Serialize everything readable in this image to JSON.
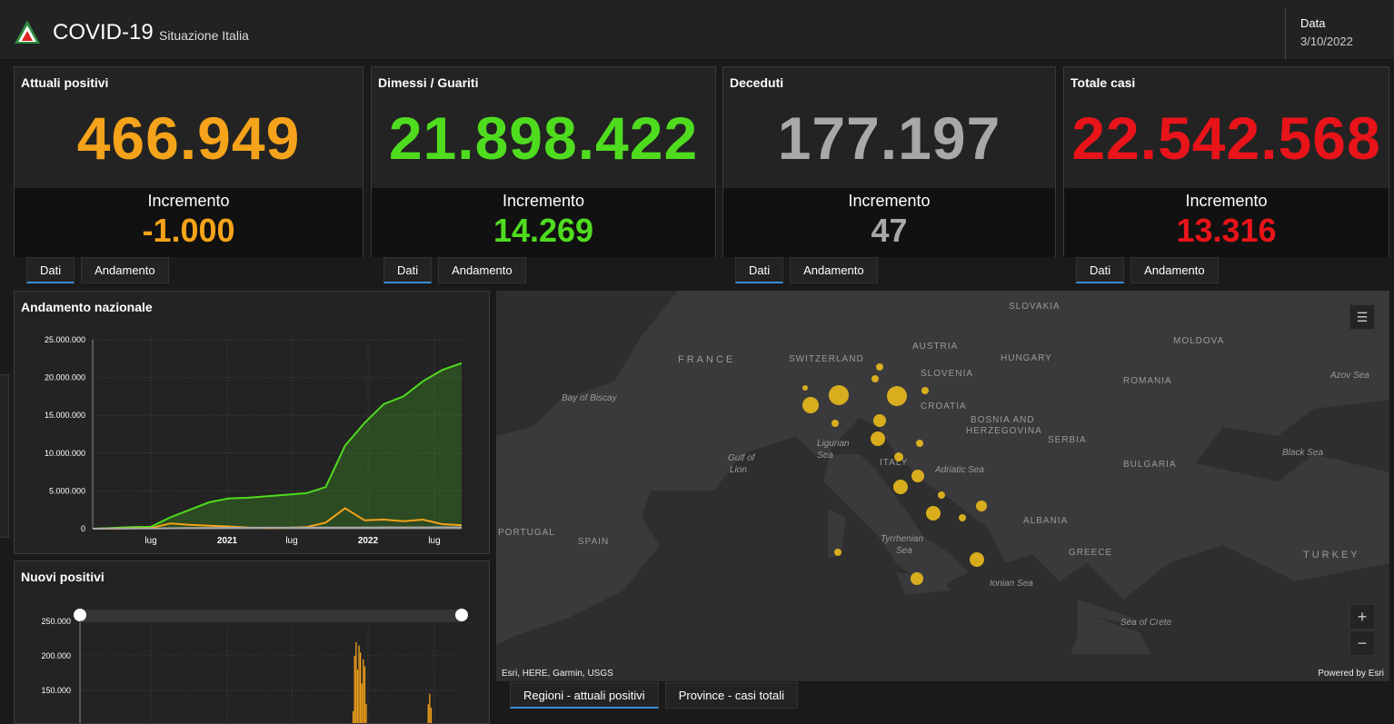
{
  "header": {
    "title": "COVID-19",
    "subtitle": "Situazione Italia",
    "date_label": "Data",
    "date_value": "3/10/2022",
    "logo_icon": "italy-civil-protection-logo"
  },
  "cards": [
    {
      "title": "Attuali positivi",
      "value": "466.949",
      "increment_label": "Incremento",
      "increment": "-1.000",
      "color": "#f5a31a"
    },
    {
      "title": "Dimessi / Guariti",
      "value": "21.898.422",
      "increment_label": "Incremento",
      "increment": "14.269",
      "color": "#4fdc1f"
    },
    {
      "title": "Deceduti",
      "value": "177.197",
      "increment_label": "Incremento",
      "increment": "47",
      "color": "#a8a8a8"
    },
    {
      "title": "Totale casi",
      "value": "22.542.568",
      "increment_label": "Incremento",
      "increment": "13.316",
      "color": "#e8141a"
    }
  ],
  "card_tabs": {
    "dati": "Dati",
    "andamento": "Andamento"
  },
  "andamento": {
    "title": "Andamento nazionale",
    "chart_data": {
      "type": "area",
      "y_ticks": [
        "25.000.000",
        "20.000.000",
        "15.000.000",
        "10.000.000",
        "5.000.000",
        "0"
      ],
      "x_ticks": [
        "lug",
        "2021",
        "lug",
        "2022",
        "lug"
      ],
      "ylim": [
        0,
        25000000
      ],
      "series": [
        {
          "color": "#4fdc1f",
          "values": [
            0,
            100000,
            200000,
            250000,
            1500000,
            2500000,
            3500000,
            4000000,
            4100000,
            4300000,
            4500000,
            4700000,
            5500000,
            11000000,
            14000000,
            16500000,
            17500000,
            19500000,
            21000000,
            21898422
          ]
        },
        {
          "color": "#f5a31a",
          "values": [
            0,
            10000,
            50000,
            100000,
            700000,
            500000,
            400000,
            300000,
            150000,
            100000,
            120000,
            200000,
            800000,
            2700000,
            1100000,
            1200000,
            1000000,
            1200000,
            600000,
            466949
          ]
        },
        {
          "color": "#a8a8a8",
          "values": [
            0,
            30000,
            35000,
            36000,
            60000,
            80000,
            100000,
            120000,
            125000,
            130000,
            132000,
            135000,
            140000,
            150000,
            160000,
            165000,
            168000,
            172000,
            175000,
            177197
          ]
        }
      ]
    }
  },
  "nuovi": {
    "title": "Nuovi positivi",
    "chart_data": {
      "type": "bar",
      "y_ticks": [
        "250.000",
        "200.000",
        "150.000"
      ],
      "ylim": [
        100000,
        260000
      ],
      "values": [
        0,
        0,
        0,
        0,
        0,
        0,
        0,
        0,
        0,
        0,
        0,
        0,
        0,
        0,
        0,
        0,
        0,
        0,
        0,
        0,
        0,
        0,
        0,
        0,
        0,
        0,
        0,
        0,
        0,
        0,
        0,
        0,
        0,
        0,
        0,
        0,
        0,
        0,
        0,
        0,
        0,
        0,
        0,
        0,
        0,
        0,
        0,
        0,
        0,
        0,
        0,
        0,
        0,
        0,
        0,
        0,
        0,
        0,
        0,
        0,
        0,
        0,
        0,
        0,
        0,
        0,
        0,
        0,
        0,
        0,
        0,
        0,
        0,
        0,
        0,
        120000,
        200000,
        220000,
        180000,
        215000,
        205000,
        160000,
        195000,
        185000,
        130000,
        0,
        0,
        0,
        0,
        0,
        0,
        0,
        0,
        0,
        0,
        0,
        0,
        0,
        0,
        0,
        0,
        0,
        0,
        0,
        0,
        0,
        130000,
        145000,
        125000,
        0,
        0,
        0,
        0,
        0,
        0,
        0
      ],
      "color": "#f5a31a"
    }
  },
  "map": {
    "attribution": "Esri, HERE, Garmin, USGS",
    "powered": "Powered by Esri",
    "labels": [
      {
        "t": "FRANCE"
      },
      {
        "t": "SWITZERLAND"
      },
      {
        "t": "AUSTRIA"
      },
      {
        "t": "SLOVAKIA"
      },
      {
        "t": "HUNGARY"
      },
      {
        "t": "MOLDOVA"
      },
      {
        "t": "SLOVENIA"
      },
      {
        "t": "CROATIA"
      },
      {
        "t": "ROMANIA"
      },
      {
        "t": "BOSNIA AND"
      },
      {
        "t": "HERZEGOVINA"
      },
      {
        "t": "SERBIA"
      },
      {
        "t": "BULGARIA"
      },
      {
        "t": "ITALY"
      },
      {
        "t": "ALBANIA"
      },
      {
        "t": "GREECE"
      },
      {
        "t": "TURKEY"
      },
      {
        "t": "SPAIN"
      },
      {
        "t": "PORTUGAL"
      },
      {
        "t": "Bay of Biscay"
      },
      {
        "t": "Gulf of"
      },
      {
        "t": "Lion"
      },
      {
        "t": "Ligurian"
      },
      {
        "t": "Sea"
      },
      {
        "t": "Adriatic Sea"
      },
      {
        "t": "Tyrrhenian"
      },
      {
        "t": "Sea"
      },
      {
        "t": "Ionian Sea"
      },
      {
        "t": "Black Sea"
      },
      {
        "t": "Azov Sea"
      },
      {
        "t": "Sea of Crete"
      }
    ],
    "zoom_in": "+",
    "zoom_out": "−",
    "legend_icon": "list-icon"
  },
  "map_tabs": {
    "regioni": "Regioni - attuali positivi",
    "province": "Province - casi totali"
  }
}
